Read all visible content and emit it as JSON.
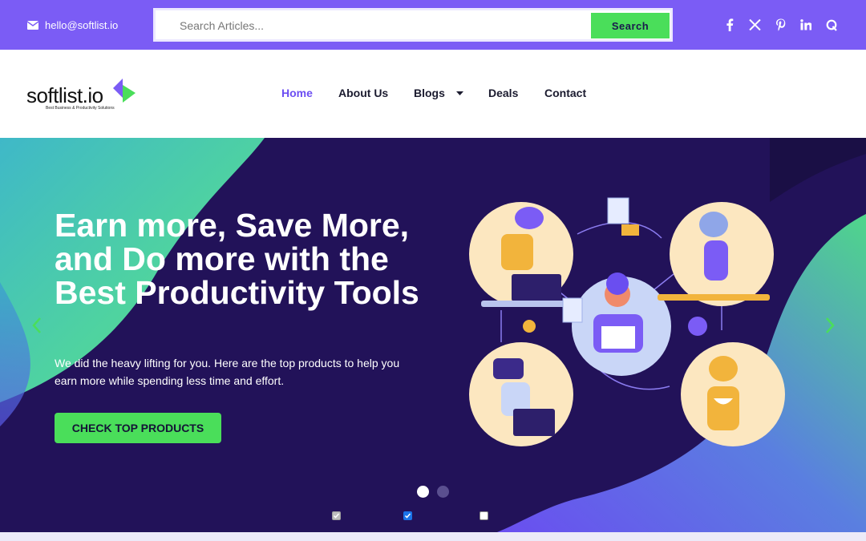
{
  "topbar": {
    "email": "hello@softlist.io",
    "search_placeholder": "Search Articles...",
    "search_button": "Search",
    "colors": {
      "bar": "#7b5cf5",
      "button": "#4ade5a"
    },
    "social_icons": [
      "facebook-icon",
      "x-twitter-icon",
      "pinterest-icon",
      "linkedin-icon",
      "quora-icon"
    ]
  },
  "header": {
    "logo_text": "softlist.io",
    "logo_tagline": "Best Business & Productivity Solutions",
    "nav": [
      "Home",
      "About Us",
      "Blogs",
      "Deals",
      "Contact"
    ],
    "active_nav": "Home",
    "accent": "#6c4ef2"
  },
  "hero": {
    "headline": "Earn more, Save More, and Do more with the Best Productivity Tools",
    "subtext": "We did the heavy lifting for you. Here are the top products to help you earn more while spending less time and effort.",
    "cta": "CHECK TOP PRODUCTS",
    "slides_total": 2,
    "active_slide": 1,
    "checkboxes": [
      {
        "checked": true,
        "disabled": true
      },
      {
        "checked": true,
        "disabled": false
      },
      {
        "checked": false,
        "disabled": false
      }
    ],
    "colors": {
      "bg": "#221259",
      "green": "#4ade5a",
      "purple": "#7b5cf5"
    }
  }
}
